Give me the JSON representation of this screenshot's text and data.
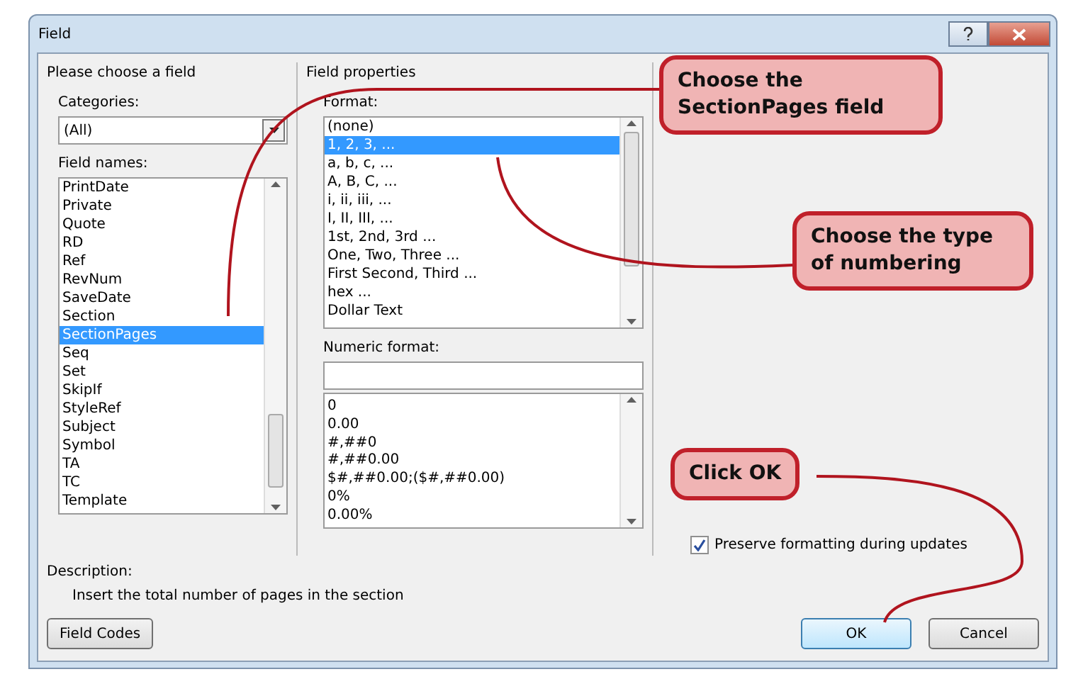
{
  "window": {
    "title": "Field"
  },
  "choose_field": {
    "title": "Please choose a field",
    "categories_label": "Categories:",
    "categories_value": "(All)",
    "field_names_label": "Field names:",
    "field_names": [
      {
        "label": "PrintDate",
        "selected": false
      },
      {
        "label": "Private",
        "selected": false
      },
      {
        "label": "Quote",
        "selected": false
      },
      {
        "label": "RD",
        "selected": false
      },
      {
        "label": "Ref",
        "selected": false
      },
      {
        "label": "RevNum",
        "selected": false
      },
      {
        "label": "SaveDate",
        "selected": false
      },
      {
        "label": "Section",
        "selected": false
      },
      {
        "label": "SectionPages",
        "selected": true
      },
      {
        "label": "Seq",
        "selected": false
      },
      {
        "label": "Set",
        "selected": false
      },
      {
        "label": "SkipIf",
        "selected": false
      },
      {
        "label": "StyleRef",
        "selected": false
      },
      {
        "label": "Subject",
        "selected": false
      },
      {
        "label": "Symbol",
        "selected": false
      },
      {
        "label": "TA",
        "selected": false
      },
      {
        "label": "TC",
        "selected": false
      },
      {
        "label": "Template",
        "selected": false
      }
    ]
  },
  "field_properties": {
    "title": "Field properties",
    "format_label": "Format:",
    "formats": [
      {
        "label": "(none)",
        "selected": false
      },
      {
        "label": "1, 2, 3, ...",
        "selected": true
      },
      {
        "label": "a, b, c, ...",
        "selected": false
      },
      {
        "label": "A, B, C, ...",
        "selected": false
      },
      {
        "label": "i, ii, iii, ...",
        "selected": false
      },
      {
        "label": "I, II, III, ...",
        "selected": false
      },
      {
        "label": "1st, 2nd, 3rd ...",
        "selected": false
      },
      {
        "label": "One, Two, Three ...",
        "selected": false
      },
      {
        "label": "First Second, Third ...",
        "selected": false
      },
      {
        "label": "hex ...",
        "selected": false
      },
      {
        "label": "Dollar Text",
        "selected": false
      }
    ],
    "numeric_format_label": "Numeric format:",
    "numeric_formats": [
      "0",
      "0.00",
      "#,##0",
      "#,##0.00",
      "$#,##0.00;($#,##0.00)",
      "0%",
      "0.00%"
    ]
  },
  "field_options": {
    "preserve_formatting": {
      "label": "Preserve formatting during updates",
      "checked": true
    }
  },
  "description": {
    "label": "Description:",
    "text": "Insert the total number of pages in the section"
  },
  "buttons": {
    "field_codes": "Field Codes",
    "ok": "OK",
    "cancel": "Cancel"
  },
  "callouts": [
    {
      "text": "Choose the SectionPages field"
    },
    {
      "text": "Choose the type of numbering"
    },
    {
      "text": "Click OK"
    }
  ]
}
